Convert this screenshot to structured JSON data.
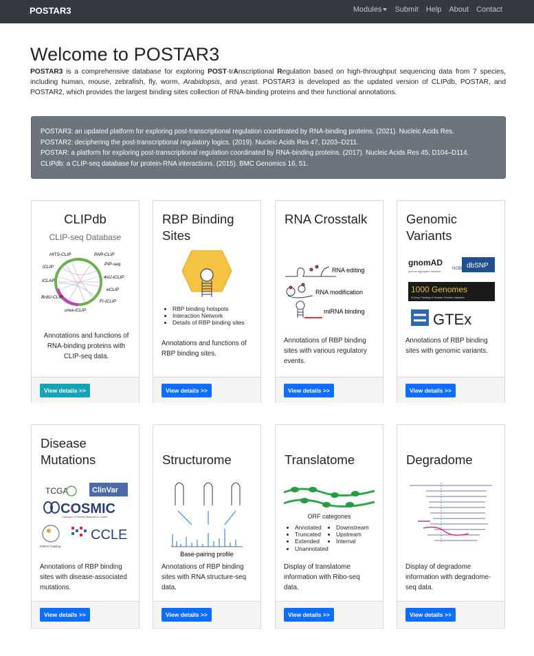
{
  "navbar": {
    "brand": "POSTAR3",
    "links": [
      "Modules",
      "Submit",
      "Help",
      "About",
      "Contact"
    ]
  },
  "intro": {
    "title": "Welcome to POSTAR3",
    "p1_bold": "POSTAR3",
    "p1_a": " is a comprehensive database for exploring ",
    "p1_post": "POST",
    "p1_tr": "-tr",
    "p1_a2": "A",
    "p1_nscriptional": "nscriptional ",
    "p1_r": "R",
    "p1_rest": "egulation based on high-throughput sequencing data from 7 species, including human, mouse, zebrafish, fly, worm, ",
    "p1_arab": "Arabidopsis",
    "p1_end": ", and yeast. POSTAR3 is developed as the updated version of CLIPdb, POSTAR, and POSTAR2, which provides the largest binding sites collection of RNA-binding proteins and their functional annotations."
  },
  "citations": [
    "POSTAR3: an updated platform for exploring post-transcriptional regulation coordinated by RNA-binding proteins. (2021). Nucleic Acids Res.",
    "POSTAR2: deciphering the post-transcriptional regulatory logics. (2019). Nucleic Acids Res 47, D203–D211.",
    "POSTAR: a platform for exploring post-transcriptional regulation coordinated by RNA-binding proteins. (2017). Nucleic Acids Res 45, D104–D114.",
    "CLIPdb: a CLIP-seq database for protein-RNA interactions. (2015). BMC Genomics 16, 51."
  ],
  "cards": {
    "clipdb": {
      "title": "CLIPdb",
      "subtitle": "CLIP-seq Database",
      "text": "Annotations and functions of RNA-binding proteins with CLIP-seq data.",
      "button": "View details >>",
      "labels": [
        "HITS-CLIP",
        "PAR-CLIP",
        "PIP-seq",
        "iCLIP",
        "4sU-iCLIP",
        "iCLAP",
        "eCLIP",
        "BrdU-CLIP",
        "Fr-iCLIP",
        "urea-iCLIP"
      ]
    },
    "rbp": {
      "title": "RBP Binding Sites",
      "text": "Annotations and functions of RBP binding sites.",
      "button": "View details >>",
      "bullets": [
        "RBP binding hotspots",
        "Interaction Network",
        "Details of RBP binding sites"
      ]
    },
    "crosstalk": {
      "title": "RNA Crosstalk",
      "text": "Annotations of RBP binding sites with various regulatory events.",
      "button": "View details >>",
      "labels": [
        "RNA editing",
        "RNA modification",
        "miRNA binding"
      ]
    },
    "genomic": {
      "title": "Genomic Variants",
      "text": "Annotations of RBP binding sites with genomic variants.",
      "button": "View details >>",
      "logos": {
        "gnomad": "gnomAD",
        "gnomad_sub": "genome aggregation database",
        "ncbi": "NCBI",
        "dbsnp": "dbSNP",
        "g1000": "1000 Genomes",
        "g1000_sub": "A Deep Catalog of Human Genetic Variation",
        "gtex": "GTEx"
      }
    },
    "disease": {
      "title": "Disease Mutations",
      "text": "Annotations of RBP binding sites with disease-associated mutations.",
      "button": "View details >>",
      "logos": {
        "tcga": "TCGA",
        "clinvar": "ClinVar",
        "cosmic": "COSMIC",
        "cosmic_sub": "Catalogue Of Somatic Mutations In Cancer",
        "gwas": "GWAS Catalog",
        "ccle": "CCLE"
      }
    },
    "structurome": {
      "title": "Structurome",
      "text": "Annotations of RBP binding sites with RNA structure-seq data.",
      "button": "View details >>",
      "caption": "Base-pairing profile"
    },
    "translatome": {
      "title": "Translatome",
      "text": "Display of translatome information with Ribo-seq data.",
      "button": "View details >>",
      "orf_title": "ORF categories",
      "orf_left": [
        "Annotated",
        "Truncated",
        "Extended",
        "Unannotated"
      ],
      "orf_right": [
        "Downstream",
        "Upstream",
        "Internal"
      ]
    },
    "degradome": {
      "title": "Degradome",
      "text": "Display of degradome information with degradome-seq data.",
      "button": "View details >>"
    }
  },
  "colors": {
    "navbar": "#343a40",
    "primary": "#0d6efd",
    "info": "#17a2b8",
    "citation_bg": "#6c757d"
  }
}
